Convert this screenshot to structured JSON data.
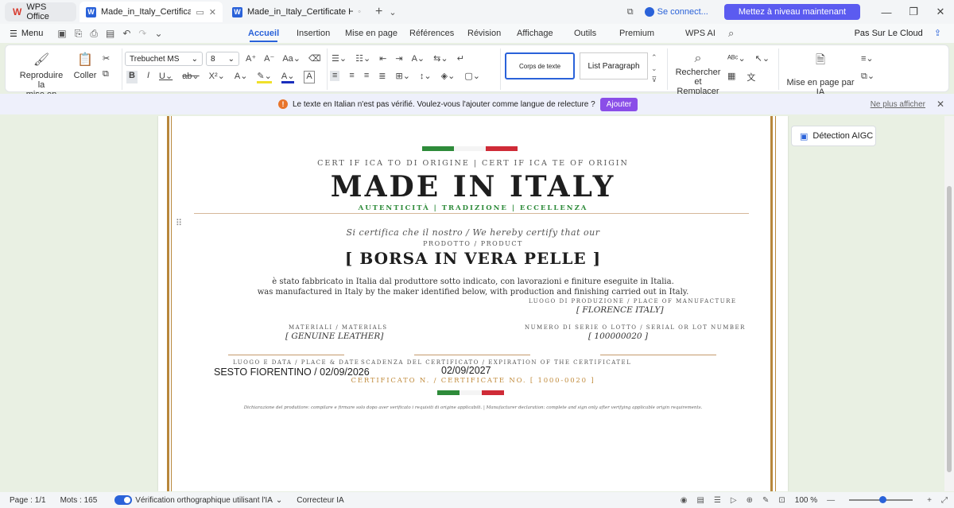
{
  "titlebar": {
    "app_name": "WPS Office",
    "tabs": [
      {
        "label": "Made_in_Italy_Certificate Ha"
      },
      {
        "label": "Made_in_Italy_Certificate Hanana"
      }
    ],
    "connect_label": "Se connect...",
    "upgrade_label": "Mettez à niveau maintenant"
  },
  "tabbar": {
    "menu_label": "Menu",
    "tabs": [
      "Accueil",
      "Insertion",
      "Mise en page",
      "Références",
      "Révision",
      "Affichage",
      "Outils",
      "Premium",
      "WPS AI"
    ],
    "cloud_label": "Pas Sur Le Cloud"
  },
  "ribbon": {
    "format_painter_line1": "Reproduire la",
    "format_painter_line2": "mise en forme",
    "paste_label": "Coller",
    "font_name": "Trebuchet MS",
    "font_size": "8",
    "style_1": "Corps de texte",
    "style_2": "List Paragraph",
    "find_line1": "Rechercher et",
    "find_line2": "Remplacer",
    "ai_layout": "Mise en page par IA"
  },
  "notification": {
    "message": "Le texte en Italian n'est pas vérifié. Voulez-vous l'ajouter comme langue de relecture ?",
    "add_label": "Ajouter",
    "dismiss_label": "Ne plus afficher"
  },
  "aigc_label": "Détection AIGC",
  "certificate": {
    "header": "CERT IF ICA TO DI ORIGINE | CERT IF ICA TE OF ORIGIN",
    "title": "MADE IN ITALY",
    "tagline": "AUTENTICITÀ | TRADIZIONE | ECCELLENZA",
    "certify_text": "Si certifica che il nostro / We hereby certify that our",
    "product_label": "PRODOTTO / PRODUCT",
    "product": "[ BORSA IN VERA PELLE ]",
    "statement_it": "è stato fabbricato in Italia dal produttore sotto indicato, con lavorazioni e finiture eseguite in Italia.",
    "statement_en": "was manufactured in Italy by the maker identified below, with production and finishing carried out in Italy.",
    "place_label": "LUOGO DI PRODUZIONE / PLACE OF MANUFACTURE",
    "place_value": "[ FLORENCE ITALY]",
    "materials_label": "MATERIALI / MATERIALS",
    "materials_value": "[ GENUINE LEATHER]",
    "serial_label": "NUMERO DI SERIE O LOTTO / SERIAL OR LOT NUMBER",
    "serial_value": "[ 100000020 ]",
    "place_date_label": "LUOGO E DATA / PLACE & DATE",
    "place_date_value": "SESTO FIORENTINO / 02/09/2026",
    "expiration_label": "SCADENZA DEL CERTIFICATO / EXPIRATION OF THE CERTIFICATEL",
    "expiration_value": "02/09/2027",
    "cert_number": "CERTIFICATO N. / CERTIFICATE NO. [ 1000-0020 ]",
    "footer": "Dichiarazione del produttore: compilare e firmare solo dopo aver verificato i requisiti di origine applicabili. | Manufacturer declaration: complete and sign only after verifying applicable origin requirements."
  },
  "status": {
    "page": "Page : 1/1",
    "words": "Mots : 165",
    "spellcheck": "Vérification orthographique utilisant l'IA",
    "corrector": "Correcteur IA",
    "zoom": "100 %"
  },
  "colors": {
    "accent": "#2a62d9",
    "gold": "#b8873c",
    "green": "#2e8b3a",
    "red": "#cf2b37"
  }
}
